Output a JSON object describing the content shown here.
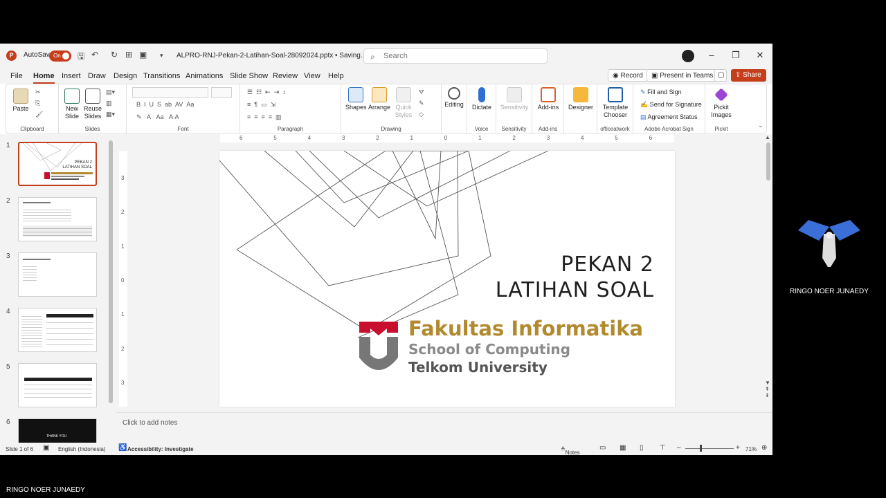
{
  "titlebar": {
    "autosave_label": "AutoSave",
    "autosave_state": "On",
    "doc_title": "ALPRO-RNJ-Pekan-2-Latihan-Soal-28092024.pptx • Saving...",
    "search_placeholder": "Search"
  },
  "menu": {
    "tabs": [
      "File",
      "Home",
      "Insert",
      "Draw",
      "Design",
      "Transitions",
      "Animations",
      "Slide Show",
      "Review",
      "View",
      "Help"
    ],
    "active": "Home",
    "record": "Record",
    "present_teams": "Present in Teams",
    "share": "Share"
  },
  "ribbon": {
    "clipboard": {
      "paste": "Paste",
      "label": "Clipboard"
    },
    "slides": {
      "new_slide": "New Slide",
      "reuse": "Reuse Slides",
      "label": "Slides"
    },
    "font": {
      "label": "Font"
    },
    "paragraph": {
      "label": "Paragraph"
    },
    "drawing": {
      "shapes": "Shapes",
      "arrange": "Arrange",
      "quick_styles": "Quick Styles",
      "label": "Drawing"
    },
    "editing": {
      "label": "Editing"
    },
    "voice": {
      "dictate": "Dictate",
      "label": "Voice"
    },
    "sensitivity": {
      "button": "Sensitivity",
      "label": "Sensitivity"
    },
    "addins": {
      "button": "Add-ins",
      "label": "Add-ins"
    },
    "designer": {
      "button": "Designer"
    },
    "officeatwork": {
      "button": "Template Chooser",
      "label": "officeatwork"
    },
    "acrobat": {
      "fill_sign": "Fill and Sign",
      "send_sig": "Send for Signature",
      "agreement": "Agreement Status",
      "label": "Adobe Acrobat Sign"
    },
    "pickit": {
      "button": "Pickit Images",
      "label": "Pickit"
    }
  },
  "thumbnails": [
    "1",
    "2",
    "3",
    "4",
    "5",
    "6"
  ],
  "thumb_texts": {
    "t1_line1": "PEKAN 2",
    "t1_line2": "LATIHAN SOAL",
    "t6": "THANK YOU"
  },
  "ruler_top": [
    "6",
    "5",
    "4",
    "3",
    "2",
    "1",
    "0",
    "1",
    "2",
    "3",
    "4",
    "5",
    "6"
  ],
  "ruler_left": [
    "3",
    "2",
    "1",
    "0",
    "1",
    "2",
    "3"
  ],
  "slide": {
    "title_line1": "PEKAN 2",
    "title_line2": "LATIHAN SOAL",
    "logo_line1": "Fakultas Informatika",
    "logo_line2": "School of Computing",
    "logo_line3": "Telkom University"
  },
  "notes_placeholder": "Click to add notes",
  "status": {
    "slide_count": "Slide 1 of 6",
    "language": "English (Indonesia)",
    "accessibility": "Accessibility: Investigate",
    "notes": "Notes",
    "zoom": "71%"
  },
  "participant": {
    "name": "RINGO NOER JUNAEDY"
  },
  "caption": "RINGO NOER JUNAEDY"
}
